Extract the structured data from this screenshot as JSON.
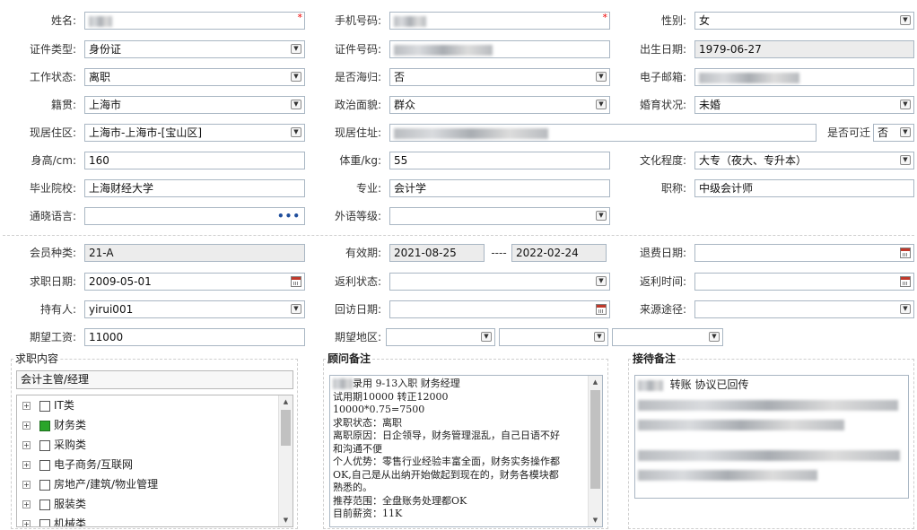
{
  "personal": {
    "name_label": "姓名:",
    "mobile_label": "手机号码:",
    "gender_label": "性别:",
    "gender_value": "女",
    "id_type_label": "证件类型:",
    "id_type_value": "身份证",
    "id_number_label": "证件号码:",
    "birth_label": "出生日期:",
    "birth_value": "1979-06-27",
    "work_status_label": "工作状态:",
    "work_status_value": "离职",
    "returnee_label": "是否海归:",
    "returnee_value": "否",
    "email_label": "电子邮箱:",
    "native_label": "籍贯:",
    "native_value": "上海市",
    "political_label": "政治面貌:",
    "political_value": "群众",
    "marital_label": "婚育状况:",
    "marital_value": "未婚",
    "residence_area_label": "现居住区:",
    "residence_area_value": "上海市-上海市-[宝山区]",
    "address_label": "现居住址:",
    "relocate_label": "是否可迁",
    "relocate_value": "否",
    "height_label": "身高/cm:",
    "height_value": "160",
    "weight_label": "体重/kg:",
    "weight_value": "55",
    "education_label": "文化程度:",
    "education_value": "大专（夜大、专升本）",
    "school_label": "毕业院校:",
    "school_value": "上海财经大学",
    "major_label": "专业:",
    "major_value": "会计学",
    "title_label": "职称:",
    "title_value": "中级会计师",
    "language_label": "通晓语言:",
    "foreign_level_label": "外语等级:"
  },
  "membership": {
    "type_label": "会员种类:",
    "type_value": "21-A",
    "validity_label": "有效期:",
    "validity_start": "2021-08-25",
    "validity_sep": "----",
    "validity_end": "2022-02-24",
    "refund_date_label": "退费日期:",
    "apply_date_label": "求职日期:",
    "apply_date_value": "2009-05-01",
    "rebate_status_label": "返利状态:",
    "rebate_time_label": "返利时间:",
    "holder_label": "持有人:",
    "holder_value": "yirui001",
    "visit_date_label": "回访日期:",
    "source_label": "来源途径:",
    "salary_label": "期望工资:",
    "salary_value": "11000",
    "region_label": "期望地区:"
  },
  "job_panel": {
    "title": "求职内容",
    "selected": "会计主管/经理",
    "categories": [
      {
        "label": "IT类",
        "checked": false
      },
      {
        "label": "财务类",
        "checked": true
      },
      {
        "label": "采购类",
        "checked": false
      },
      {
        "label": "电子商务/互联网",
        "checked": false
      },
      {
        "label": "房地产/建筑/物业管理",
        "checked": false
      },
      {
        "label": "服装类",
        "checked": false
      },
      {
        "label": "机械类",
        "checked": false
      }
    ]
  },
  "consultant_panel": {
    "title": "顾问备注",
    "lines": [
      "录用   9-13入职 财务经理",
      "试用期10000 转正12000",
      "10000*0.75=7500",
      "求职状态：离职",
      "离职原因：日企领导，财务管理混乱，自己日语不好",
      "和沟通不便",
      "个人优势：零售行业经验丰富全面，财务实务操作都",
      "OK,自己是从出纳开始做起到现在的，财务各模块都",
      "熟悉的。",
      "推荐范围：全盘账务处理都OK",
      "目前薪资：11K"
    ]
  },
  "reception_panel": {
    "title": "接待备注",
    "first_line": "转账 协议已回传"
  },
  "colors": {
    "required_mark": "#e00000",
    "checkbox_checked": "#2aa52a",
    "readonly_bg": "#ececec",
    "border": "#a9b6c3"
  },
  "icons": {
    "dropdown": "chevron-down-icon",
    "calendar": "calendar-icon",
    "more": "ellipsis-icon",
    "tree_expand": "plus-icon"
  },
  "glyphs": {
    "required": "*",
    "dropdown": "▼",
    "up": "▲",
    "more": "•••",
    "plus": "+"
  }
}
